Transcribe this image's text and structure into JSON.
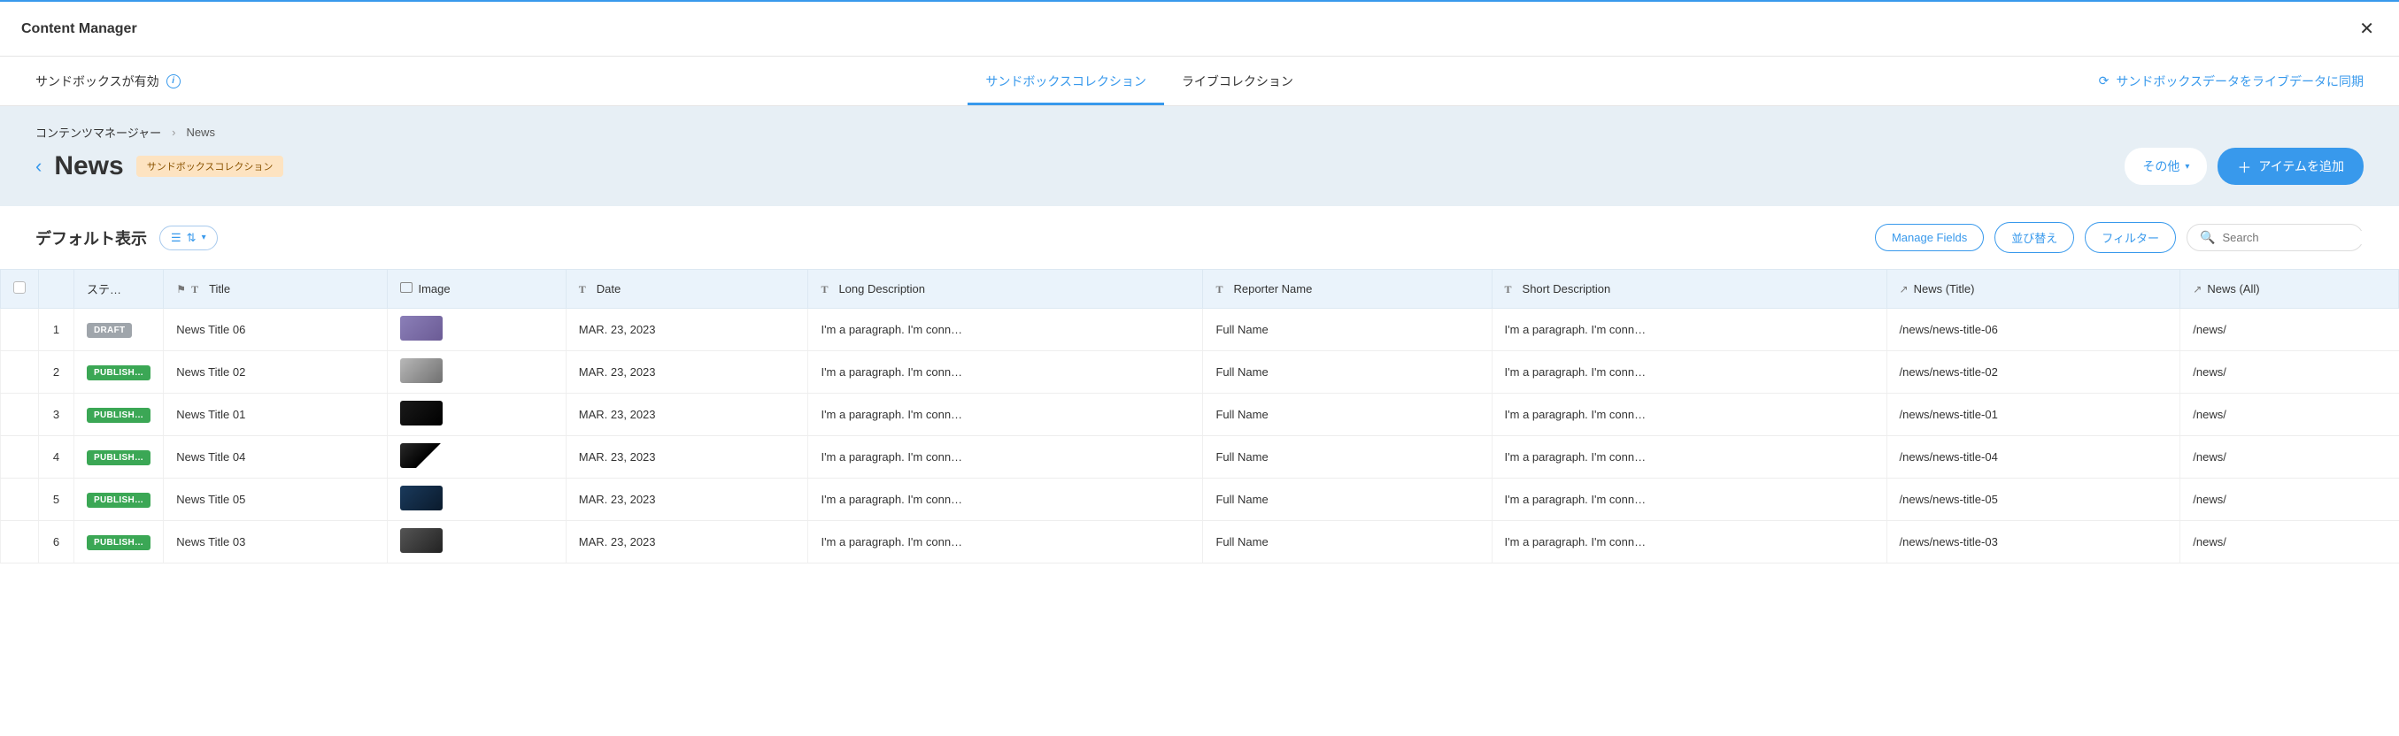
{
  "header": {
    "title": "Content Manager"
  },
  "subheader": {
    "sandbox_notice": "サンドボックスが有効",
    "tabs": {
      "sandbox": "サンドボックスコレクション",
      "live": "ライブコレクション"
    },
    "sync_link": "サンドボックスデータをライブデータに同期"
  },
  "breadcrumb": {
    "root": "コンテンツマネージャー",
    "current": "News"
  },
  "page": {
    "title": "News",
    "badge": "サンドボックスコレクション",
    "btn_other": "その他",
    "btn_add": "アイテムを追加"
  },
  "view": {
    "label": "デフォルト表示",
    "btn_manage_fields": "Manage Fields",
    "btn_sort": "並び替え",
    "btn_filter": "フィルター",
    "search_placeholder": "Search"
  },
  "columns": {
    "status": "ステ…",
    "title": "Title",
    "image": "Image",
    "date": "Date",
    "long_desc": "Long Description",
    "reporter": "Reporter Name",
    "short_desc": "Short Description",
    "news_title": "News (Title)",
    "news_all": "News (All)"
  },
  "status_labels": {
    "draft": "DRAFT",
    "published": "PUBLISH…"
  },
  "rows": [
    {
      "num": "1",
      "status": "draft",
      "title": "News Title 06",
      "date": "MAR. 23, 2023",
      "long_desc": "I'm a paragraph. I'm conn…",
      "reporter": "Full Name",
      "short_desc": "I'm a paragraph. I'm conn…",
      "news_title": "/news/news-title-06",
      "news_all": "/news/",
      "thumb": "thumb-1"
    },
    {
      "num": "2",
      "status": "published",
      "title": "News Title 02",
      "date": "MAR. 23, 2023",
      "long_desc": "I'm a paragraph. I'm conn…",
      "reporter": "Full Name",
      "short_desc": "I'm a paragraph. I'm conn…",
      "news_title": "/news/news-title-02",
      "news_all": "/news/",
      "thumb": "thumb-2"
    },
    {
      "num": "3",
      "status": "published",
      "title": "News Title 01",
      "date": "MAR. 23, 2023",
      "long_desc": "I'm a paragraph. I'm conn…",
      "reporter": "Full Name",
      "short_desc": "I'm a paragraph. I'm conn…",
      "news_title": "/news/news-title-01",
      "news_all": "/news/",
      "thumb": "thumb-3"
    },
    {
      "num": "4",
      "status": "published",
      "title": "News Title 04",
      "date": "MAR. 23, 2023",
      "long_desc": "I'm a paragraph. I'm conn…",
      "reporter": "Full Name",
      "short_desc": "I'm a paragraph. I'm conn…",
      "news_title": "/news/news-title-04",
      "news_all": "/news/",
      "thumb": "thumb-4"
    },
    {
      "num": "5",
      "status": "published",
      "title": "News Title 05",
      "date": "MAR. 23, 2023",
      "long_desc": "I'm a paragraph. I'm conn…",
      "reporter": "Full Name",
      "short_desc": "I'm a paragraph. I'm conn…",
      "news_title": "/news/news-title-05",
      "news_all": "/news/",
      "thumb": "thumb-5"
    },
    {
      "num": "6",
      "status": "published",
      "title": "News Title 03",
      "date": "MAR. 23, 2023",
      "long_desc": "I'm a paragraph. I'm conn…",
      "reporter": "Full Name",
      "short_desc": "I'm a paragraph. I'm conn…",
      "news_title": "/news/news-title-03",
      "news_all": "/news/",
      "thumb": "thumb-6"
    }
  ]
}
